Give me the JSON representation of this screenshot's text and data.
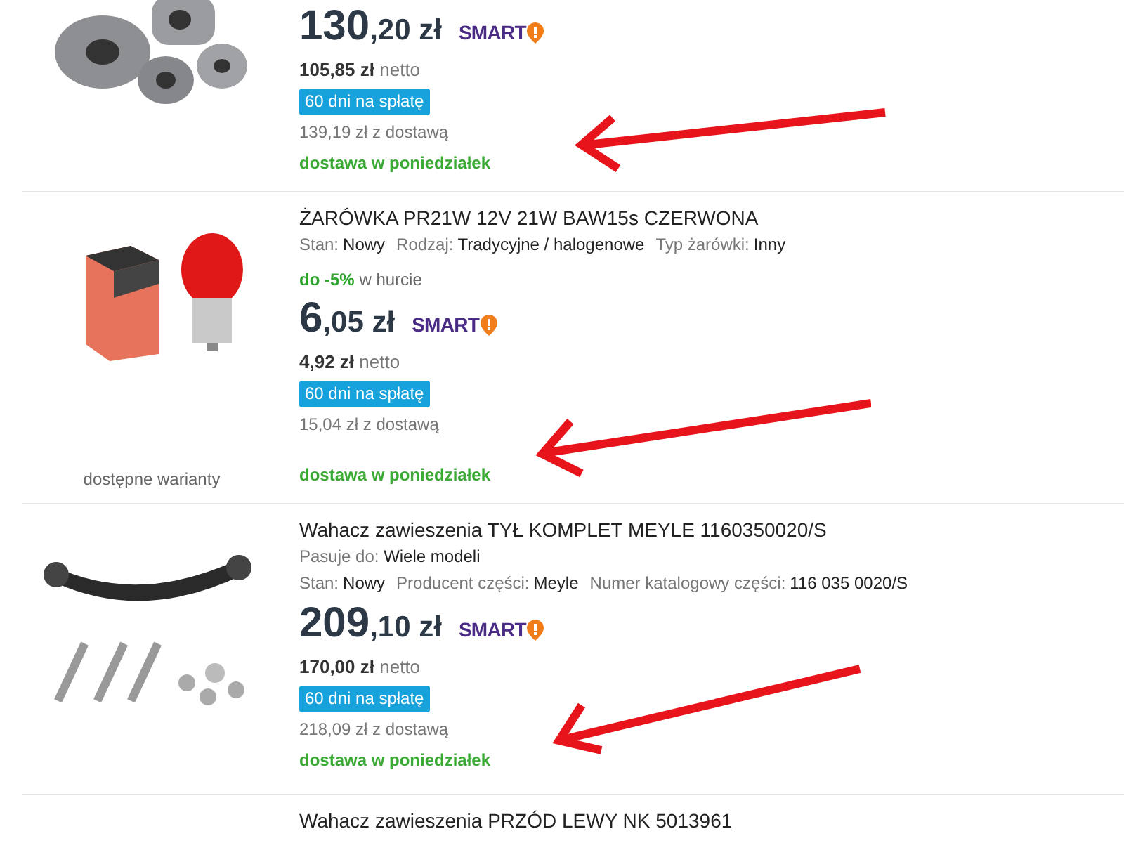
{
  "listings": [
    {
      "price_main": "130",
      "price_rest": ",20 zł",
      "smart": "SMART",
      "netto_amount": "105,85 zł",
      "netto_label": "netto",
      "installments": "60 dni na spłatę",
      "delivery_price": "139,19 zł z dostawą",
      "delivery_date": "dostawa w poniedziałek",
      "arrow": true
    },
    {
      "title": "ŻARÓWKA PR21W 12V 21W BAW15s CZERWONA",
      "params": [
        {
          "label": "Stan:",
          "value": "Nowy"
        },
        {
          "label": "Rodzaj:",
          "value": "Tradycyjne / halogenowe"
        },
        {
          "label": "Typ żarówki:",
          "value": "Inny"
        }
      ],
      "wholesale_discount": "do -5%",
      "wholesale_label": "w hurcie",
      "price_main": "6",
      "price_rest": ",05 zł",
      "smart": "SMART",
      "netto_amount": "4,92 zł",
      "netto_label": "netto",
      "installments": "60 dni na spłatę",
      "delivery_price": "15,04 zł z dostawą",
      "delivery_date": "dostawa w poniedziałek",
      "variants": "dostępne warianty",
      "arrow": true
    },
    {
      "title": "Wahacz zawieszenia TYŁ KOMPLET MEYLE 1160350020/S",
      "fits": {
        "label": "Pasuje do:",
        "value": "Wiele modeli"
      },
      "params": [
        {
          "label": "Stan:",
          "value": "Nowy"
        },
        {
          "label": "Producent części:",
          "value": "Meyle"
        },
        {
          "label": "Numer katalogowy części:",
          "value": "116 035 0020/S"
        }
      ],
      "price_main": "209",
      "price_rest": ",10 zł",
      "smart": "SMART",
      "netto_amount": "170,00 zł",
      "netto_label": "netto",
      "installments": "60 dni na spłatę",
      "delivery_price": "218,09 zł z dostawą",
      "delivery_date": "dostawa w poniedziałek",
      "arrow": true
    },
    {
      "title": "Wahacz zawieszenia PRZÓD LEWY NK 5013961"
    }
  ]
}
